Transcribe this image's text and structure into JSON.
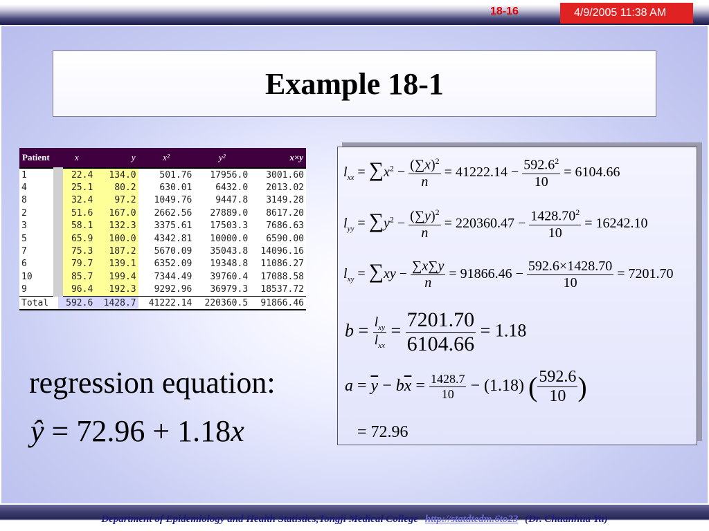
{
  "header": {
    "slide_number": "18-16",
    "datetime": "4/9/2005 11:38 AM"
  },
  "title": "Example 18-1",
  "table": {
    "headers": [
      "Patient",
      "x",
      "y",
      "x²",
      "y²",
      "x×y"
    ],
    "rows": [
      [
        "1",
        "22.4",
        "134.0",
        "501.76",
        "17956.0",
        "3001.60"
      ],
      [
        "4",
        "25.1",
        "80.2",
        "630.01",
        "6432.0",
        "2013.02"
      ],
      [
        "8",
        "32.4",
        "97.2",
        "1049.76",
        "9447.8",
        "3149.28"
      ],
      [
        "2",
        "51.6",
        "167.0",
        "2662.56",
        "27889.0",
        "8617.20"
      ],
      [
        "3",
        "58.1",
        "132.3",
        "3375.61",
        "17503.3",
        "7686.63"
      ],
      [
        "5",
        "65.9",
        "100.0",
        "4342.81",
        "10000.0",
        "6590.00"
      ],
      [
        "7",
        "75.3",
        "187.2",
        "5670.09",
        "35043.8",
        "14096.16"
      ],
      [
        "6",
        "79.7",
        "139.1",
        "6352.09",
        "19348.8",
        "11086.27"
      ],
      [
        "10",
        "85.7",
        "199.4",
        "7344.49",
        "39760.4",
        "17088.58"
      ],
      [
        "9",
        "96.4",
        "192.3",
        "9292.96",
        "36979.3",
        "18537.72"
      ]
    ],
    "total": [
      "Total",
      "592.6",
      "1428.7",
      "41222.14",
      "220360.5",
      "91866.46"
    ]
  },
  "regression": {
    "label": "regression equation:",
    "equation": "72.96 + 1.18"
  },
  "formulas": {
    "lxx": {
      "sum_term": "41222.14",
      "num": "592.6",
      "den": "10",
      "result": "6104.66"
    },
    "lyy": {
      "sum_term": "220360.47",
      "num": "1428.70",
      "den": "10",
      "result": "16242.10"
    },
    "lxy": {
      "sum_term": "91866.46",
      "num": "592.6×1428.70",
      "den": "10",
      "result": "7201.70"
    },
    "b": {
      "num": "7201.70",
      "den": "6104.66",
      "result": "1.18"
    },
    "a": {
      "ybar_num": "1428.7",
      "ybar_den": "10",
      "coef": "(1.18)",
      "xbar_num": "592.6",
      "xbar_den": "10",
      "result": "72.96"
    }
  },
  "footer": {
    "department": "Department of Epidemiology and Health Statistics,Tongji Medical College",
    "link": "http://statdtedm.6to23",
    "author": "(Dr. Chuanhua Yu)"
  }
}
